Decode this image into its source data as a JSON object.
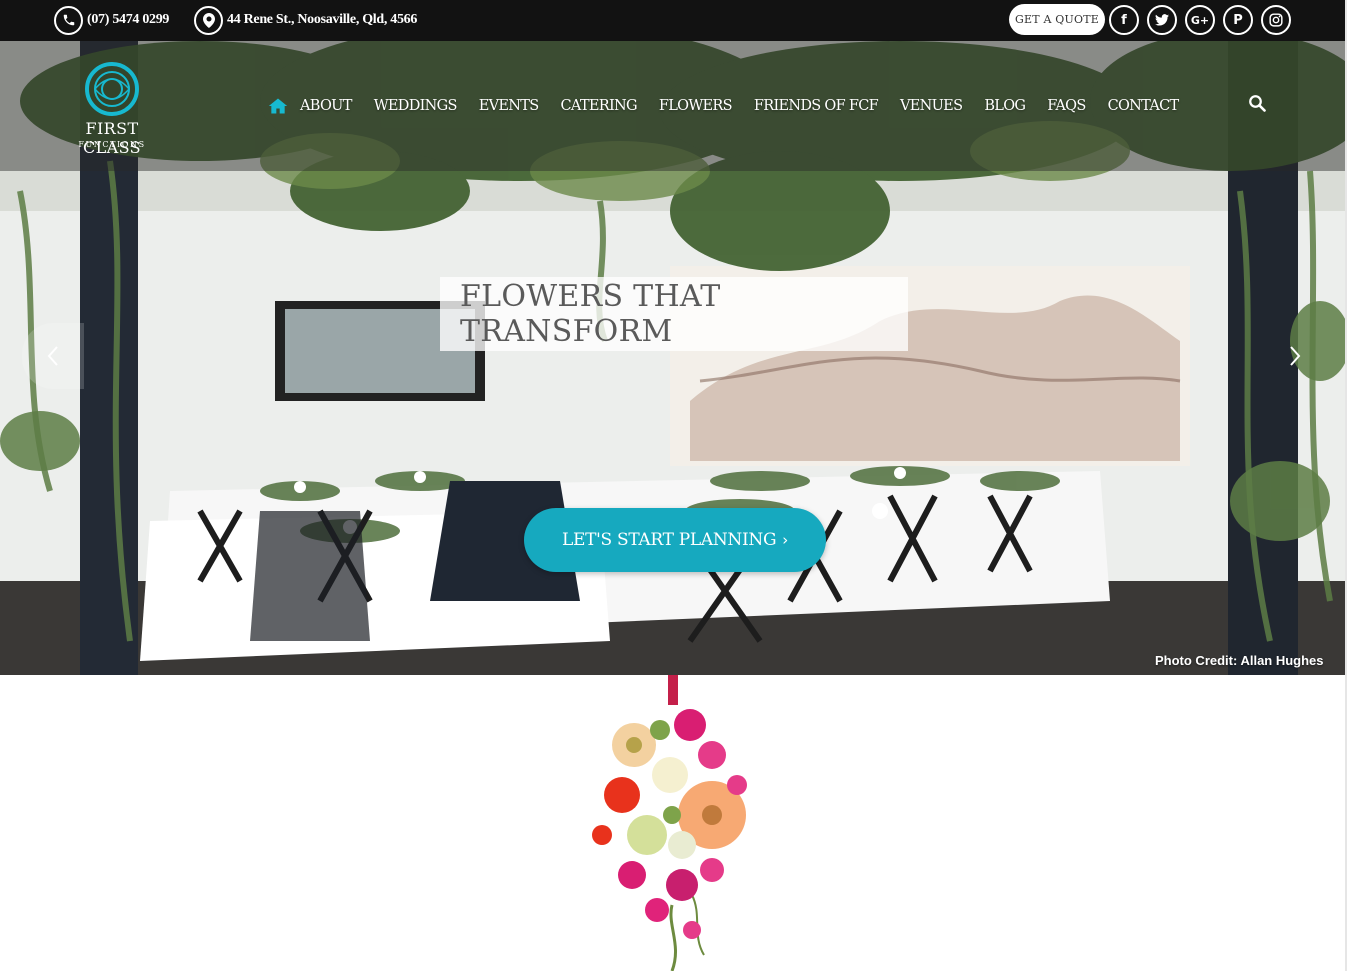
{
  "topbar": {
    "phone": "(07) 5474 0299",
    "address": "44 Rene St., Noosaville, Qld, 4566",
    "quote_button": "GET A QUOTE",
    "social": [
      "facebook-icon",
      "twitter-icon",
      "google-plus-icon",
      "pinterest-icon",
      "instagram-icon"
    ]
  },
  "logo": {
    "name": "FIRST CLASS",
    "sub": "FUNCTIONS"
  },
  "nav": {
    "items": [
      "ABOUT",
      "WEDDINGS",
      "EVENTS",
      "CATERING",
      "FLOWERS",
      "FRIENDS OF FCF",
      "VENUES",
      "BLOG",
      "FAQS",
      "CONTACT"
    ]
  },
  "hero": {
    "headline": "FLOWERS THAT TRANSFORM",
    "cta": "LET'S START PLANNING",
    "credit": "Photo Credit: Allan Hughes"
  },
  "colors": {
    "accent": "#16a9bf",
    "topbar": "#121212"
  }
}
